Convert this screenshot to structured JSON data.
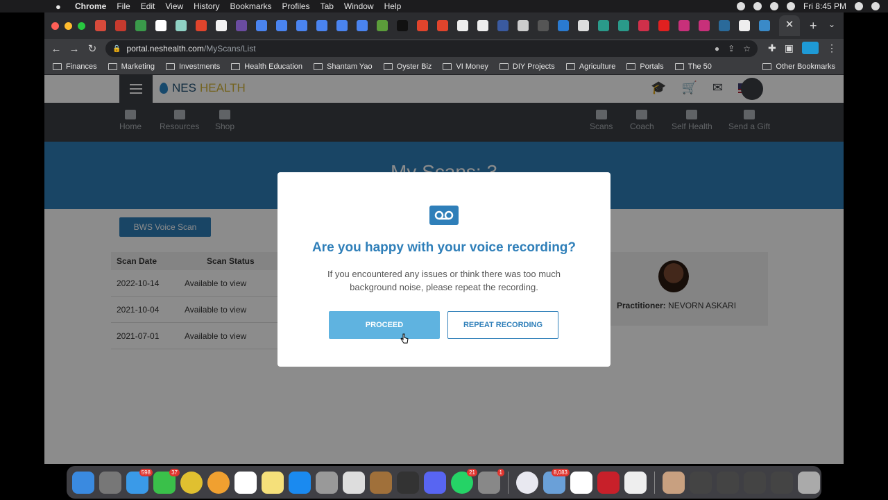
{
  "menubar": {
    "app": "Chrome",
    "items": [
      "File",
      "Edit",
      "View",
      "History",
      "Bookmarks",
      "Profiles",
      "Tab",
      "Window",
      "Help"
    ],
    "clock": "Fri 8:45 PM"
  },
  "browser": {
    "url_host": "portal.neshealth.com",
    "url_path": "/MyScans/List",
    "bookmarks": [
      "Finances",
      "Marketing",
      "Investments",
      "Health Education",
      "Shantam Yao",
      "Oyster Biz",
      "VI Money",
      "DIY Projects",
      "Agriculture",
      "Portals",
      "The 50"
    ],
    "other_bookmarks": "Other Bookmarks"
  },
  "site": {
    "logo_nes": "NES",
    "logo_health": "HEALTH",
    "nav_left": [
      "Home",
      "Resources",
      "Shop"
    ],
    "nav_right": [
      "Scans",
      "Coach",
      "Self Health",
      "Send a Gift"
    ],
    "banner_title": "My Scans: 3",
    "bws_button": "BWS Voice Scan",
    "table": {
      "headers": [
        "Scan Date",
        "Scan Status"
      ],
      "rows": [
        [
          "2022-10-14",
          "Available to view"
        ],
        [
          "2021-10-04",
          "Available to view"
        ],
        [
          "2021-07-01",
          "Available to view"
        ]
      ]
    },
    "practitioner_label": "Practitioner:",
    "practitioner_name": "NEVORN ASKARI"
  },
  "modal": {
    "title": "Are you happy with your voice recording?",
    "text": "If you encountered any issues or think there was too much background noise, please repeat the recording.",
    "proceed": "PROCEED",
    "repeat": "REPEAT RECORDING"
  },
  "dock": {
    "badges": [
      "598",
      "37",
      "21",
      "1",
      "8,083"
    ]
  }
}
